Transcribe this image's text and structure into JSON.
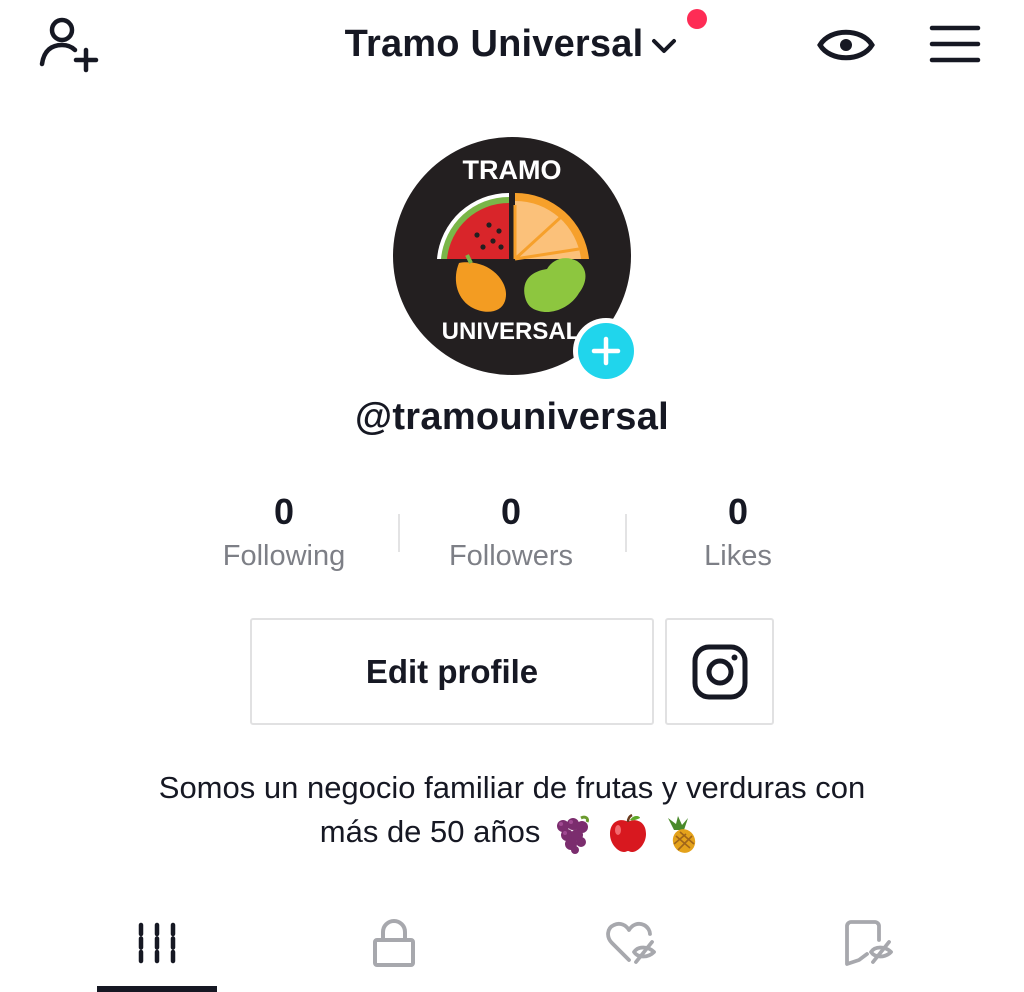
{
  "header": {
    "title": "Tramo Universal",
    "icons": {
      "add_user": "add-user-icon",
      "chevron": "chevron-down-icon",
      "eye": "eye-icon",
      "menu": "hamburger-menu-icon"
    },
    "notification_color": "#fe2c55"
  },
  "profile": {
    "username": "@tramouniversal",
    "avatar_text_top": "TRAMO",
    "avatar_text_bottom": "UNIVERSAL",
    "add_badge_color": "#20d5ec"
  },
  "stats": [
    {
      "value": "0",
      "label": "Following"
    },
    {
      "value": "0",
      "label": "Followers"
    },
    {
      "value": "0",
      "label": "Likes"
    }
  ],
  "buttons": {
    "edit_profile": "Edit profile",
    "instagram_icon": "instagram-icon"
  },
  "bio": {
    "line1": "Somos un negocio familiar de frutas y verduras con",
    "line2": "más de 50 años",
    "emojis": [
      "grapes-icon",
      "apple-icon",
      "pineapple-icon"
    ]
  },
  "tabs": [
    {
      "name": "videos",
      "icon": "grid-icon",
      "active": true
    },
    {
      "name": "private",
      "icon": "lock-icon",
      "active": false
    },
    {
      "name": "liked",
      "icon": "hidden-heart-icon",
      "active": false
    },
    {
      "name": "favorites",
      "icon": "hidden-bookmark-icon",
      "active": false
    }
  ]
}
